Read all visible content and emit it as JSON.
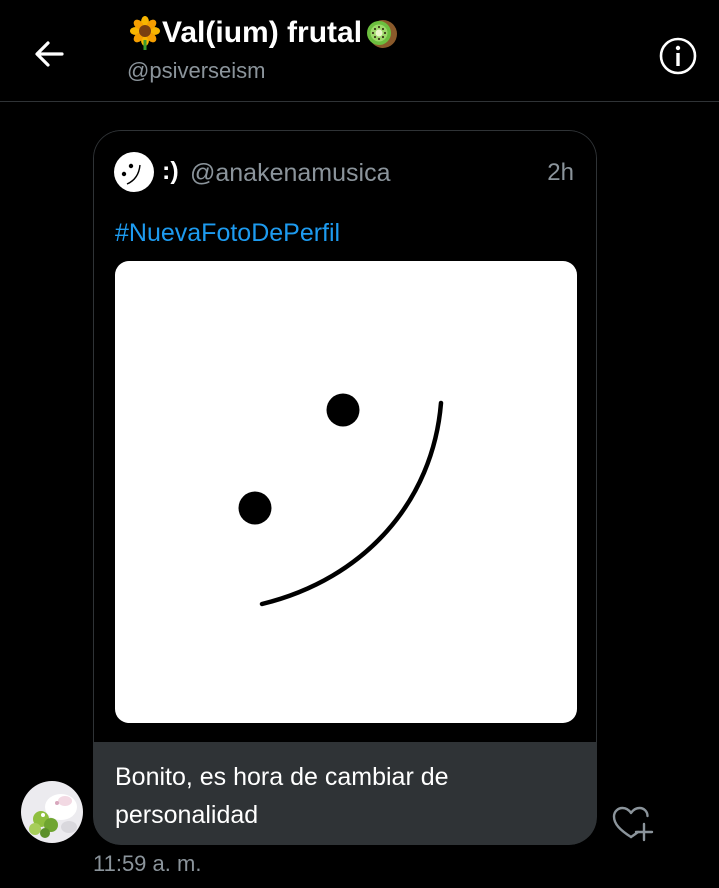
{
  "header": {
    "title": "Val(ium) frutal",
    "handle": "@psiverseism",
    "title_emoji_left": "sunflower-emoji",
    "title_emoji_right": "kiwi-emoji"
  },
  "quoted_tweet": {
    "display_name": ":)",
    "username": "@anakenamusica",
    "time": "2h",
    "hashtag": "#NuevaFotoDePerfil"
  },
  "message": {
    "text": "Bonito, es hora de cambiar de personalidad",
    "timestamp": "11:59 a. m."
  },
  "colors": {
    "background": "#000000",
    "link": "#1d9bf0",
    "muted": "#8b949b",
    "bubble": "#2f3336"
  }
}
